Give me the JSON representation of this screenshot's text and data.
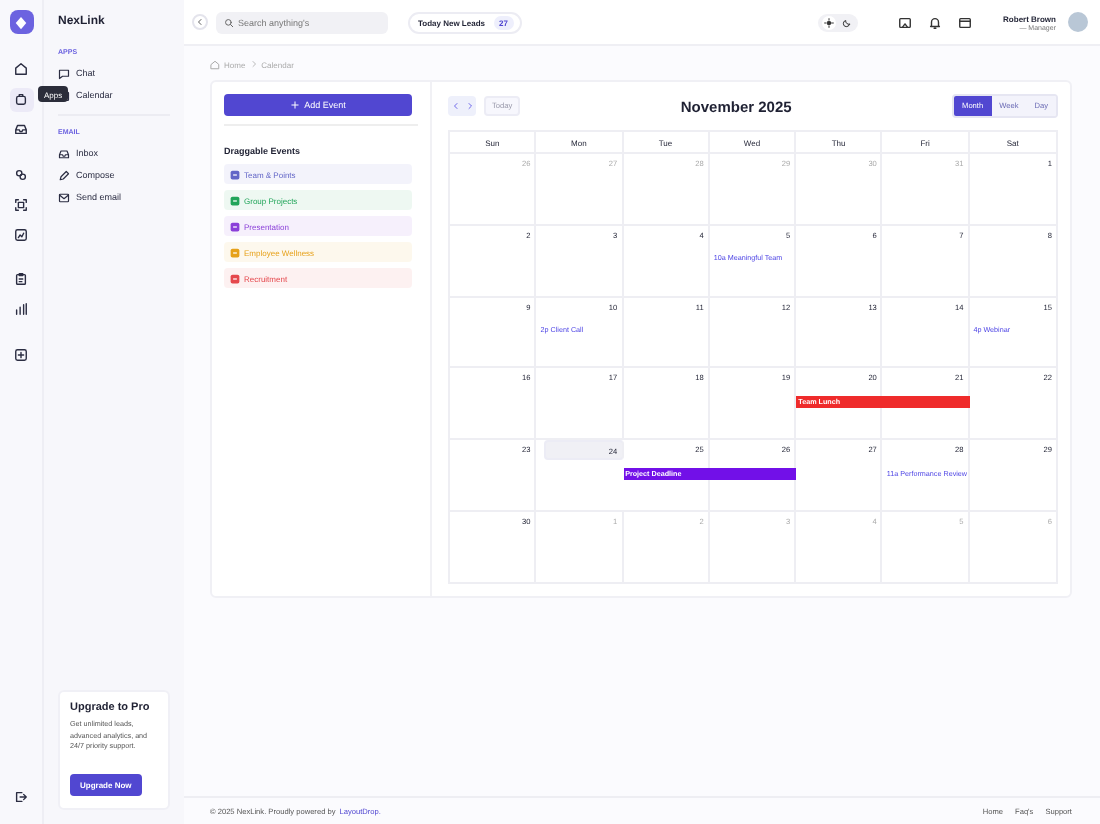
{
  "rail": {
    "items": [
      {
        "kind": "home",
        "selected": false
      },
      {
        "kind": "apps",
        "selected": true
      },
      {
        "kind": "inbox",
        "selected": false
      },
      {
        "kind": "link",
        "selected": false
      },
      {
        "kind": "scan",
        "selected": false
      },
      {
        "kind": "chart",
        "selected": false
      },
      {
        "kind": "clipboard",
        "selected": false
      },
      {
        "kind": "bars",
        "selected": false
      },
      {
        "kind": "add",
        "selected": false
      }
    ],
    "tooltip": "Apps"
  },
  "sidebar": {
    "brand": "NexLink",
    "sections": [
      {
        "title": "APPS",
        "items": [
          {
            "kind": "chat",
            "label": "Chat"
          },
          {
            "kind": "calendar",
            "label": "Calendar"
          }
        ]
      },
      {
        "title": "EMAIL",
        "items": [
          {
            "kind": "inbox",
            "label": "Inbox"
          },
          {
            "kind": "compose",
            "label": "Compose"
          },
          {
            "kind": "mail",
            "label": "Send email"
          }
        ]
      }
    ],
    "upgrade": {
      "title": "Upgrade to Pro",
      "text": "Get unlimited leads, advanced analytics, and 24/7 priority support.",
      "button": "Upgrade Now"
    }
  },
  "header": {
    "search_placeholder": "Search anything's",
    "leads_label": "Today New Leads",
    "leads_count": "27",
    "dark_mode": false,
    "user_name": "Robert Brown",
    "user_role": "— Manager"
  },
  "breadcrumb": [
    "Home",
    "Calendar"
  ],
  "events_panel": {
    "add_button": "Add Event",
    "title": "Draggable Events",
    "events": [
      {
        "label": "Team & Points",
        "color": "#6366c7"
      },
      {
        "label": "Group Projects",
        "color": "#22a55a"
      },
      {
        "label": "Presentation",
        "color": "#8b3fd9"
      },
      {
        "label": "Employee Wellness",
        "color": "#e6a11a"
      },
      {
        "label": "Recruitment",
        "color": "#e5484d"
      }
    ]
  },
  "calendar": {
    "title": "November 2025",
    "today_button": "Today",
    "views": [
      {
        "label": "Month",
        "selected": true
      },
      {
        "label": "Week",
        "selected": false
      },
      {
        "label": "Day",
        "selected": false
      }
    ],
    "weekdays": [
      "Sun",
      "Mon",
      "Tue",
      "Wed",
      "Thu",
      "Fri",
      "Sat"
    ],
    "weeks": [
      {
        "days": [
          {
            "day": "26",
            "outside": true,
            "today": false
          },
          {
            "day": "27",
            "outside": true,
            "today": false
          },
          {
            "day": "28",
            "outside": true,
            "today": false
          },
          {
            "day": "29",
            "outside": true,
            "today": false
          },
          {
            "day": "30",
            "outside": true,
            "today": false
          },
          {
            "day": "31",
            "outside": true,
            "today": false
          },
          {
            "day": "1",
            "outside": false,
            "today": false
          }
        ]
      },
      {
        "days": [
          {
            "day": "2",
            "outside": false,
            "today": false
          },
          {
            "day": "3",
            "outside": false,
            "today": false
          },
          {
            "day": "4",
            "outside": false,
            "today": false
          },
          {
            "day": "5",
            "outside": false,
            "today": false,
            "events": [
              {
                "kind": "timed",
                "label": "10a Meaningful Team"
              }
            ]
          },
          {
            "day": "6",
            "outside": false,
            "today": false
          },
          {
            "day": "7",
            "outside": false,
            "today": false
          },
          {
            "day": "8",
            "outside": false,
            "today": false
          }
        ]
      },
      {
        "days": [
          {
            "day": "9",
            "outside": false,
            "today": false
          },
          {
            "day": "10",
            "outside": false,
            "today": false,
            "events": [
              {
                "kind": "timed",
                "label": "2p Client Call"
              }
            ]
          },
          {
            "day": "11",
            "outside": false,
            "today": false
          },
          {
            "day": "12",
            "outside": false,
            "today": false
          },
          {
            "day": "13",
            "outside": false,
            "today": false
          },
          {
            "day": "14",
            "outside": false,
            "today": false
          },
          {
            "day": "15",
            "outside": false,
            "today": false,
            "events": [
              {
                "kind": "timed",
                "label": "4p Webinar"
              }
            ]
          }
        ]
      },
      {
        "days": [
          {
            "day": "16",
            "outside": false,
            "today": false
          },
          {
            "day": "17",
            "outside": false,
            "today": false
          },
          {
            "day": "18",
            "outside": false,
            "today": false
          },
          {
            "day": "19",
            "outside": false,
            "today": false
          },
          {
            "day": "20",
            "outside": false,
            "today": false,
            "events": [
              {
                "kind": "bar",
                "label": "Team Lunch",
                "color": "#ef2b2b"
              }
            ]
          },
          {
            "day": "21",
            "outside": false,
            "today": false,
            "bar_continues": true
          },
          {
            "day": "22",
            "outside": false,
            "today": false
          }
        ]
      },
      {
        "days": [
          {
            "day": "23",
            "outside": false,
            "today": false
          },
          {
            "day": "24",
            "outside": false,
            "today": true
          },
          {
            "day": "25",
            "outside": false,
            "today": false,
            "events": [
              {
                "kind": "bar",
                "label": "Project Deadline",
                "color": "#7210e8"
              }
            ]
          },
          {
            "day": "26",
            "outside": false,
            "today": false,
            "bar_continues": true
          },
          {
            "day": "27",
            "outside": false,
            "today": false
          },
          {
            "day": "28",
            "outside": false,
            "today": false,
            "events": [
              {
                "kind": "timed",
                "label": "11a Performance Review"
              }
            ]
          },
          {
            "day": "29",
            "outside": false,
            "today": false
          }
        ]
      },
      {
        "days": [
          {
            "day": "30",
            "outside": false,
            "today": false
          },
          {
            "day": "1",
            "outside": true,
            "today": false
          },
          {
            "day": "2",
            "outside": true,
            "today": false
          },
          {
            "day": "3",
            "outside": true,
            "today": false
          },
          {
            "day": "4",
            "outside": true,
            "today": false
          },
          {
            "day": "5",
            "outside": true,
            "today": false
          },
          {
            "day": "6",
            "outside": true,
            "today": false
          }
        ]
      }
    ]
  },
  "footer": {
    "copyright": "© 2025 NexLink. Proudly powered by",
    "link": "LayoutDrop.",
    "links": [
      "Home",
      "Faq's",
      "Support"
    ]
  }
}
